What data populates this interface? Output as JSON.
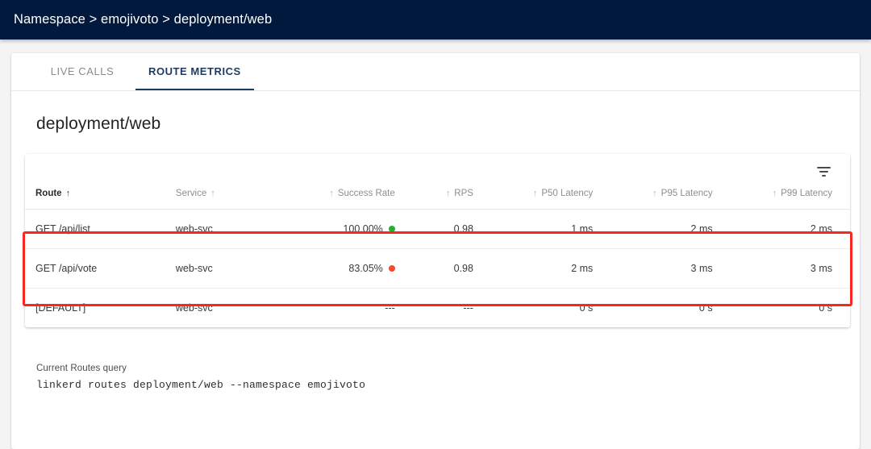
{
  "topbar": {
    "breadcrumb": "Namespace > emojivoto > deployment/web",
    "background_color": "#00193c"
  },
  "tabs": [
    {
      "label": "LIVE CALLS",
      "active": false
    },
    {
      "label": "ROUTE METRICS",
      "active": true
    }
  ],
  "page_title": "deployment/web",
  "table": {
    "filter_icon": "filter-icon",
    "sort_arrow": "↑",
    "columns": [
      {
        "label": "Route",
        "align": "left",
        "arrow_side": "after",
        "sorted": true
      },
      {
        "label": "Service",
        "align": "left",
        "arrow_side": "after",
        "sorted": false
      },
      {
        "label": "Success Rate",
        "align": "right",
        "arrow_side": "before",
        "sorted": false
      },
      {
        "label": "RPS",
        "align": "right",
        "arrow_side": "before",
        "sorted": false
      },
      {
        "label": "P50 Latency",
        "align": "right",
        "arrow_side": "before",
        "sorted": false
      },
      {
        "label": "P95 Latency",
        "align": "right",
        "arrow_side": "before",
        "sorted": false
      },
      {
        "label": "P99 Latency",
        "align": "right",
        "arrow_side": "before",
        "sorted": false
      }
    ],
    "rows": [
      {
        "route": "GET /api/list",
        "service": "web-svc",
        "success_rate": "100.00%",
        "status_dot": "#27ae38",
        "rps": "0.98",
        "p50": "1 ms",
        "p95": "2 ms",
        "p99": "2 ms"
      },
      {
        "route": "GET /api/vote",
        "service": "web-svc",
        "success_rate": "83.05%",
        "status_dot": "#f94832",
        "rps": "0.98",
        "p50": "2 ms",
        "p95": "3 ms",
        "p99": "3 ms"
      },
      {
        "route": "[DEFAULT]",
        "service": "web-svc",
        "success_rate": "---",
        "status_dot": null,
        "rps": "---",
        "p50": "0 s",
        "p95": "0 s",
        "p99": "0 s"
      }
    ]
  },
  "highlight": {
    "color": "#f8281e"
  },
  "footer": {
    "query_label": "Current Routes query",
    "query_command": "linkerd routes deployment/web --namespace emojivoto"
  }
}
